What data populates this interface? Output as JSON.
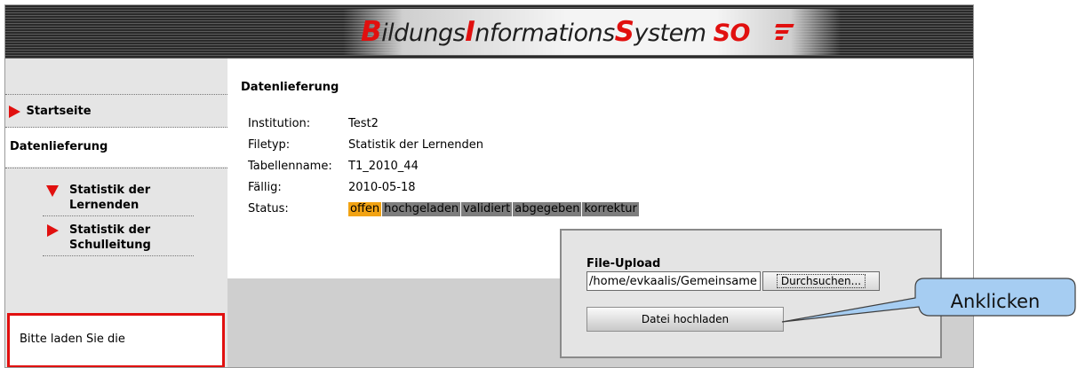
{
  "header": {
    "logo_parts": [
      {
        "text": "B",
        "style": "cap"
      },
      {
        "text": "ildungs",
        "style": "plain"
      },
      {
        "text": "I",
        "style": "cap"
      },
      {
        "text": "nformations",
        "style": "plain"
      },
      {
        "text": "S",
        "style": "cap"
      },
      {
        "text": "ystem ",
        "style": "plain"
      },
      {
        "text": "SO",
        "style": "so"
      }
    ]
  },
  "sidebar": {
    "home": "Startseite",
    "current": "Datenlieferung",
    "sub_items": [
      {
        "line1": "Statistik der",
        "line2": "Lernenden",
        "icon": "triangle-down-icon"
      },
      {
        "line1": "Statistik der",
        "line2": "Schulleitung",
        "icon": "triangle-right-icon"
      }
    ],
    "notice": "Bitte laden Sie die"
  },
  "main": {
    "heading": "Datenlieferung",
    "info": [
      {
        "label": "Institution:",
        "value": "Test2"
      },
      {
        "label": "Filetyp:",
        "value": "Statistik der Lernenden"
      },
      {
        "label": "Tabellenname:",
        "value": "T1_2010_44"
      },
      {
        "label": "Fällig:",
        "value": "2010-05-18"
      }
    ],
    "status_label": "Status:",
    "status_steps": [
      "offen",
      "hochgeladen",
      "validiert",
      "abgegeben",
      "korrektur"
    ],
    "status_active_index": 0
  },
  "upload": {
    "title": "File-Upload",
    "file_value": "/home/evkaalis/Gemeinsame",
    "browse_label": "Durchsuchen...",
    "submit_label": "Datei hochladen"
  },
  "callout": {
    "text": "Anklicken"
  },
  "colors": {
    "accent_red": "#e1100f",
    "status_active": "#f2a313",
    "status_inactive": "#7d7d7d",
    "callout_fill": "#a6cdf2"
  }
}
